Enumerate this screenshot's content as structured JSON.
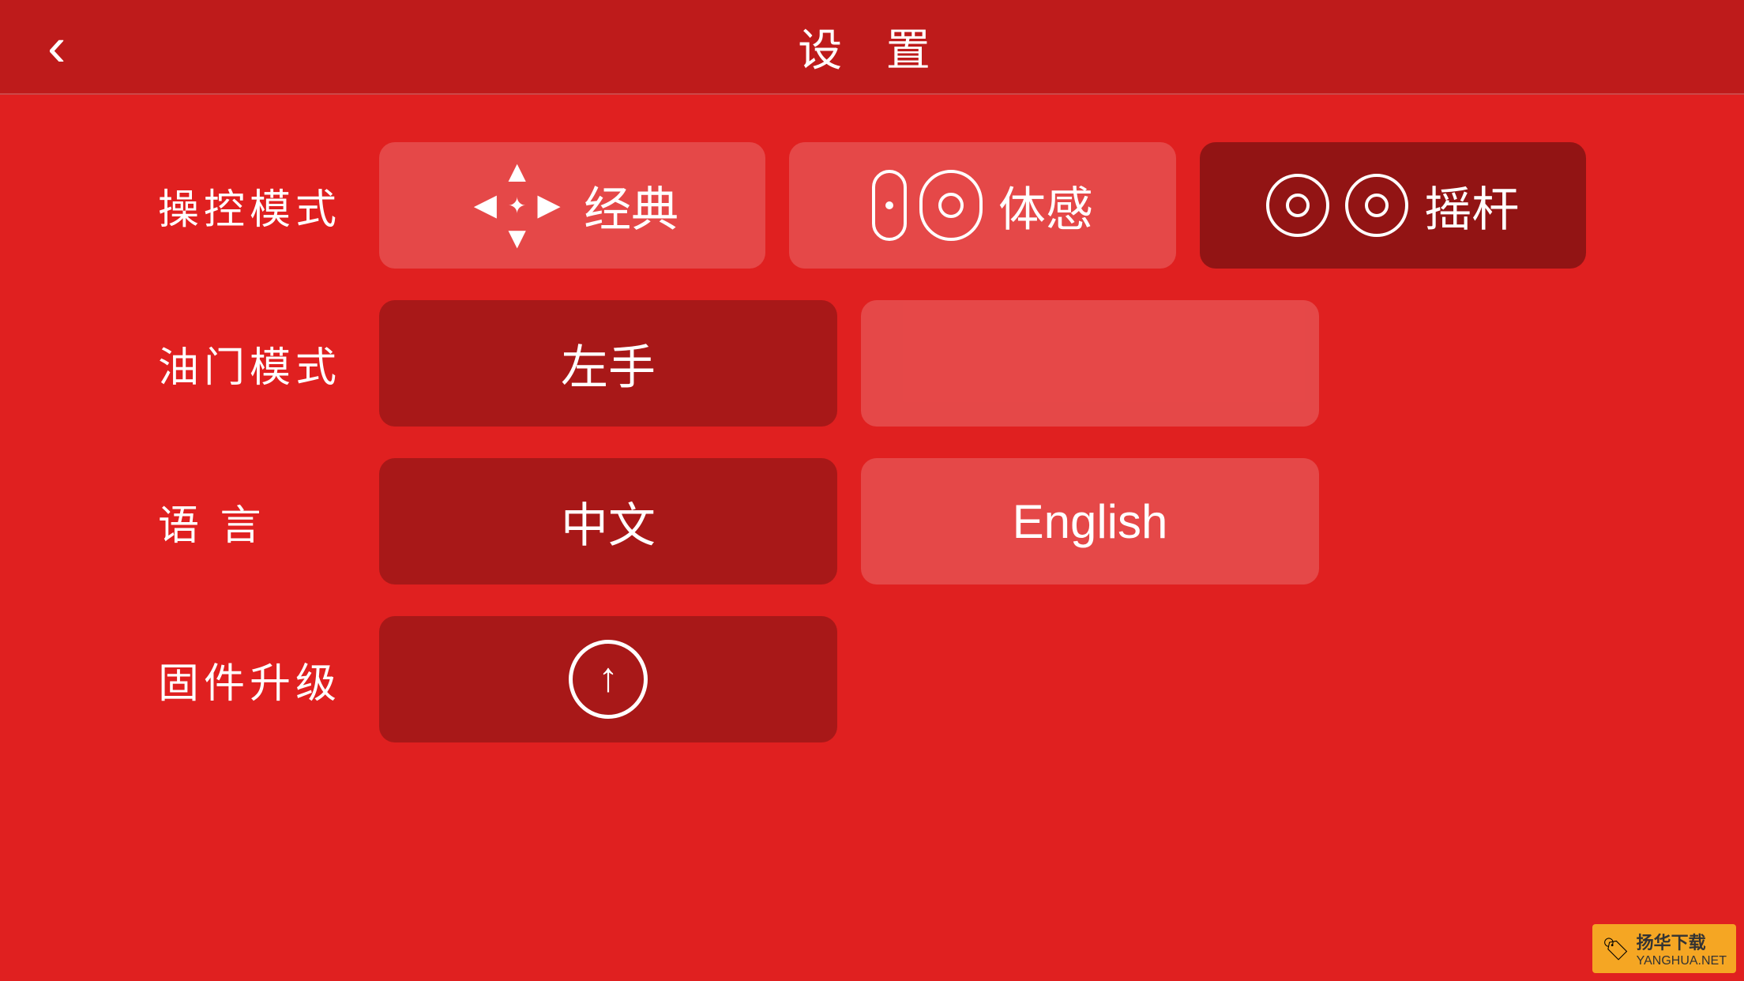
{
  "header": {
    "title": "设 置",
    "back_label": "‹"
  },
  "rows": [
    {
      "id": "control-mode",
      "label": "操控模式",
      "options": [
        {
          "id": "classic",
          "label": "经典",
          "state": "inactive",
          "icon": "dpad"
        },
        {
          "id": "motion",
          "label": "体感",
          "state": "inactive",
          "icon": "motion"
        },
        {
          "id": "joystick",
          "label": "摇杆",
          "state": "active",
          "icon": "joystick"
        }
      ]
    },
    {
      "id": "throttle-mode",
      "label": "油门模式",
      "options": [
        {
          "id": "left-hand",
          "label": "左手",
          "state": "active",
          "icon": "none"
        },
        {
          "id": "right-hand",
          "label": "",
          "state": "inactive",
          "icon": "none"
        }
      ]
    },
    {
      "id": "language",
      "label": "语 言",
      "options": [
        {
          "id": "chinese",
          "label": "中文",
          "state": "active",
          "icon": "none"
        },
        {
          "id": "english",
          "label": "English",
          "state": "inactive",
          "icon": "none"
        }
      ]
    },
    {
      "id": "firmware",
      "label": "固件升级",
      "options": [
        {
          "id": "upload",
          "label": "",
          "state": "active",
          "icon": "upload"
        }
      ]
    }
  ],
  "watermark": {
    "icon": "🏷",
    "text": "扬华下载",
    "subtext": "YANGHUA.NET"
  }
}
